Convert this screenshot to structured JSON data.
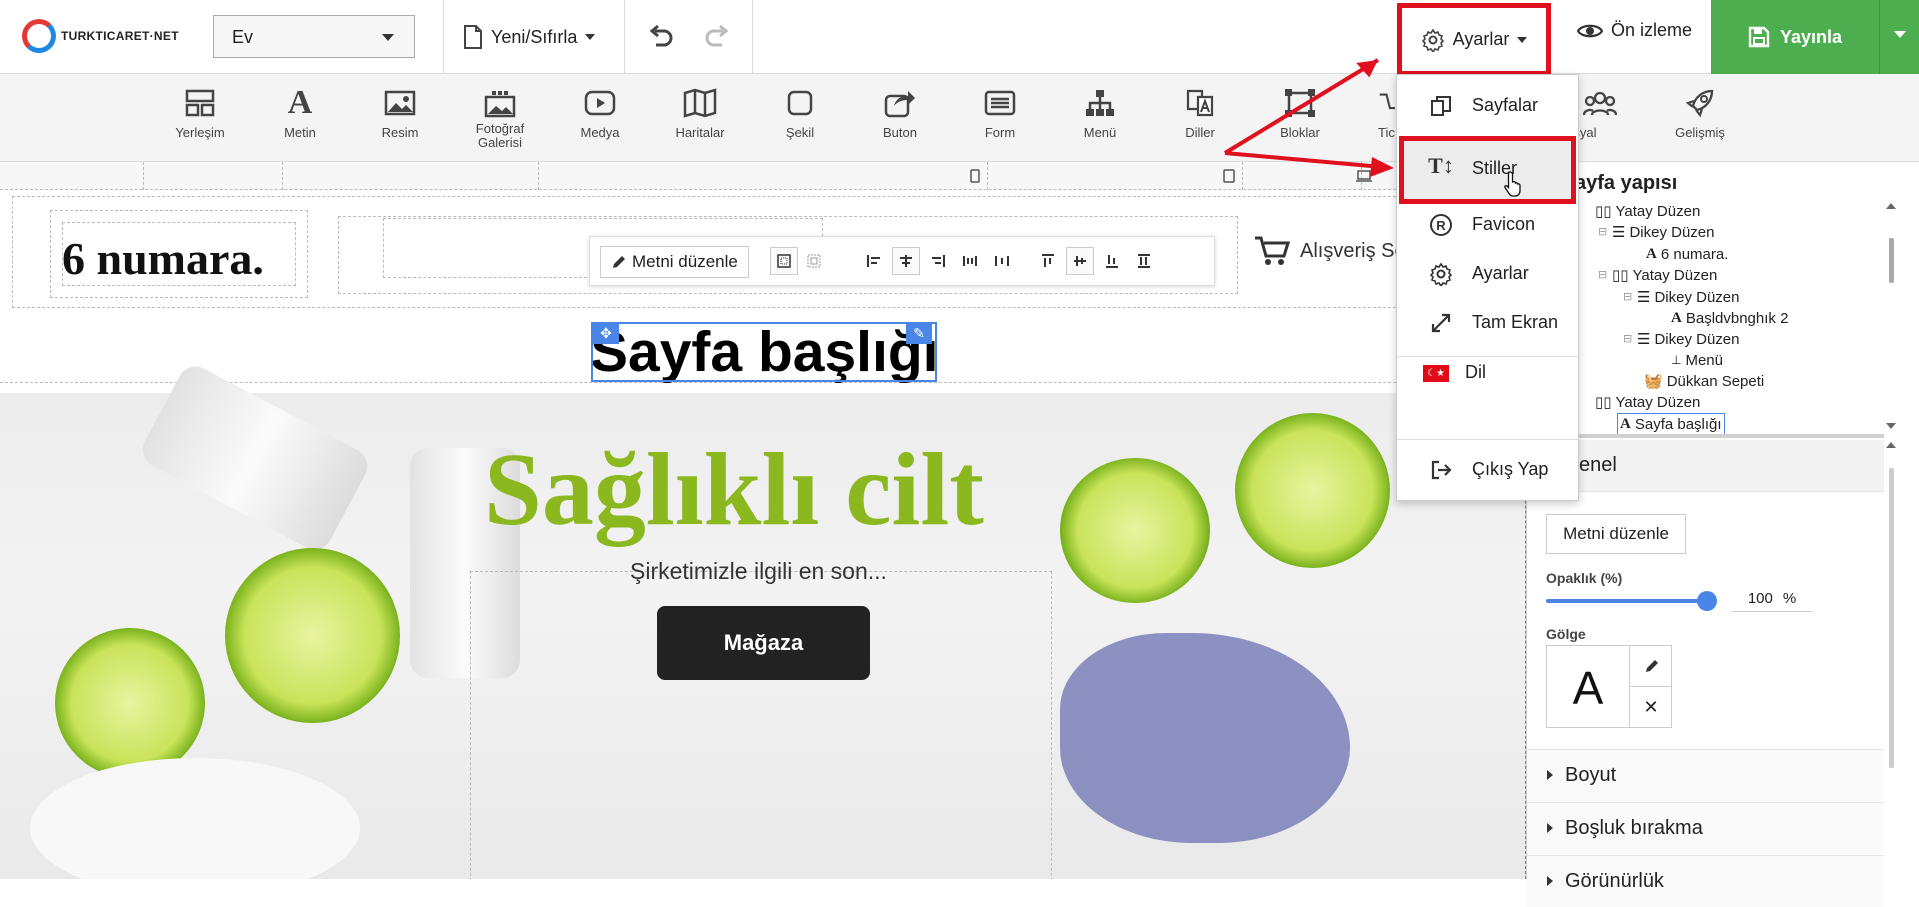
{
  "header": {
    "logo_text": "TURKTICARET·NET",
    "page_select": "Ev",
    "reset_label": "Yeni/Sıfırla",
    "settings_label": "Ayarlar",
    "preview_label": "Ön izleme",
    "publish_label": "Yayınla"
  },
  "toolbar": {
    "items": [
      {
        "label": "Yerleşim"
      },
      {
        "label": "Metin"
      },
      {
        "label": "Resim"
      },
      {
        "label": "Fotoğraf Galerisi"
      },
      {
        "label": "Medya"
      },
      {
        "label": "Haritalar"
      },
      {
        "label": "Şekil"
      },
      {
        "label": "Buton"
      },
      {
        "label": "Form"
      },
      {
        "label": "Menü"
      },
      {
        "label": "Diller"
      },
      {
        "label": "Bloklar"
      },
      {
        "label": "Tic"
      },
      {
        "label": "Sosyal"
      },
      {
        "label": "Gelişmiş"
      }
    ]
  },
  "canvas": {
    "logo_text": "6 numara.",
    "edit_text_label": "Metni düzenle",
    "cart_label": "Alışveriş Se",
    "page_title": "Sayfa başlığı",
    "hero_title": "Sağlıklı cilt",
    "hero_subtitle": "Şirketimizle ilgili en son...",
    "shop_button": "Mağaza"
  },
  "settings_menu": {
    "items": [
      "Sayfalar",
      "Stiller",
      "Favicon",
      "Ayarlar",
      "Tam Ekran",
      "Dil",
      "Çıkış Yap"
    ],
    "flag_text": "☾★"
  },
  "structure_panel": {
    "title": "ayfa yapısı",
    "tree": [
      "Yatay Düzen",
      "Dikey Düzen",
      "6 numara.",
      "Yatay Düzen",
      "Dikey Düzen",
      "Başldvbnghık 2",
      "Dikey Düzen",
      "Menü",
      "Dükkan Sepeti",
      "Yatay Düzen",
      "Sayfa başlığı"
    ]
  },
  "properties": {
    "section_general": "enel",
    "edit_text_btn": "Metni düzenle",
    "opacity_label": "Opaklık (%)",
    "opacity_value": "100",
    "opacity_unit": "%",
    "opacity_fraction": 1.0,
    "shadow_label": "Gölge",
    "shadow_preview": "A",
    "section_size": "Boyut",
    "section_spacing": "Boşluk bırakma",
    "section_next": "Görünürlük"
  },
  "colors": {
    "accent": "#4a86e8",
    "publish": "#4cae4f",
    "highlight": "#e0101e",
    "hero_title": "#8ab81e"
  }
}
